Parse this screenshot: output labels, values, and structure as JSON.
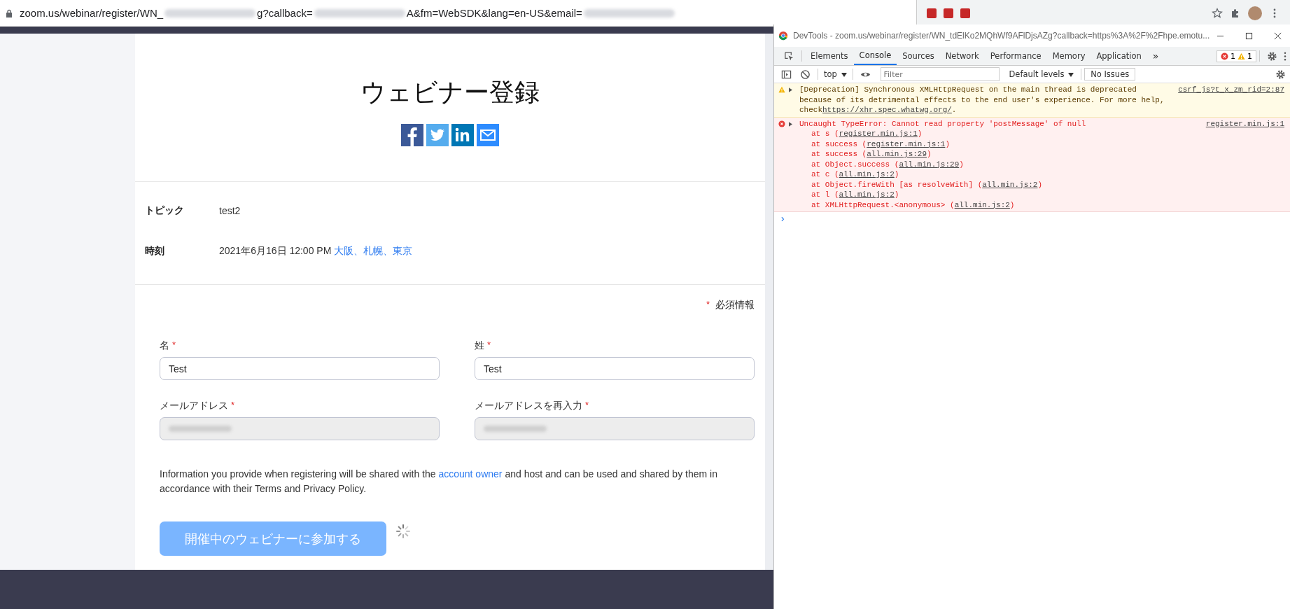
{
  "address_bar": {
    "segments": [
      {
        "kind": "text",
        "text": "zoom.us/webinar/register/WN_"
      },
      {
        "kind": "blurred"
      },
      {
        "kind": "text",
        "text": "g?callback="
      },
      {
        "kind": "blurred"
      },
      {
        "kind": "text",
        "text": "A&fm=WebSDK&lang=en-US&email="
      },
      {
        "kind": "blurred"
      }
    ]
  },
  "page": {
    "title": "ウェビナー登録",
    "details": [
      {
        "label": "トピック",
        "value": "test2"
      },
      {
        "label": "時刻",
        "value": "2021年6月16日 12:00 PM",
        "link": "大阪、札幌、東京"
      }
    ],
    "required_mark": "*",
    "required_note": "必須情報",
    "fields": [
      {
        "label": "名",
        "mark": "*",
        "kind": "text",
        "value": "Test"
      },
      {
        "label": "姓",
        "mark": "*",
        "kind": "text",
        "value": "Test"
      },
      {
        "label": "メールアドレス",
        "mark": "*",
        "kind": "blurred"
      },
      {
        "label": "メールアドレスを再入力",
        "mark": "*",
        "kind": "blurred"
      }
    ],
    "notice": {
      "before": "Information you provide when registering will be shared with the",
      "link": "account owner",
      "after": "and host and can be used and shared by them in accordance with their Terms and Privacy Policy."
    },
    "submit": {
      "label": "開催中のウェビナーに参加する",
      "disabled": true,
      "loading": true
    }
  },
  "devtools": {
    "title": "DevTools - zoom.us/webinar/register/WN_tdElKo2MQhWf9AFlDjsAZg?callback=https%3A%2F%2Fhpe.emotu...",
    "tabs": [
      {
        "label": "Elements",
        "selected": false
      },
      {
        "label": "Console",
        "selected": true
      },
      {
        "label": "Sources",
        "selected": false
      },
      {
        "label": "Network",
        "selected": false
      },
      {
        "label": "Performance",
        "selected": false
      },
      {
        "label": "Memory",
        "selected": false
      },
      {
        "label": "Application",
        "selected": false
      }
    ],
    "more": "»",
    "errors": "1",
    "warnings": "1",
    "context": "top",
    "filter_placeholder": "Filter",
    "levels": "Default levels",
    "issues": "No Issues",
    "messages": [
      {
        "kind": "warning",
        "text": "[Deprecation] Synchronous XMLHttpRequest on the main thread is deprecated because of its detrimental effects to the end user's experience. For more help, check",
        "link": "https://xhr.spec.whatwg.org/",
        "tail": ".",
        "source": "csrf_js?t_x_zm_rid=2:87"
      },
      {
        "kind": "error",
        "text": "Uncaught TypeError: Cannot read property 'postMessage' of null",
        "source": "register.min.js:1",
        "stack": [
          {
            "before": "at s (",
            "link": "register.min.js:1",
            "after": ")"
          },
          {
            "before": "at success (",
            "link": "register.min.js:1",
            "after": ")"
          },
          {
            "before": "at success (",
            "link": "all.min.js:29",
            "after": ")"
          },
          {
            "before": "at Object.success (",
            "link": "all.min.js:29",
            "after": ")"
          },
          {
            "before": "at c (",
            "link": "all.min.js:2",
            "after": ")"
          },
          {
            "before": "at Object.fireWith [as resolveWith] (",
            "link": "all.min.js:2",
            "after": ")"
          },
          {
            "before": "at l (",
            "link": "all.min.js:2",
            "after": ")"
          },
          {
            "before": "at XMLHttpRequest.<anonymous> (",
            "link": "all.min.js:2",
            "after": ")"
          }
        ]
      }
    ],
    "prompt": "›"
  }
}
